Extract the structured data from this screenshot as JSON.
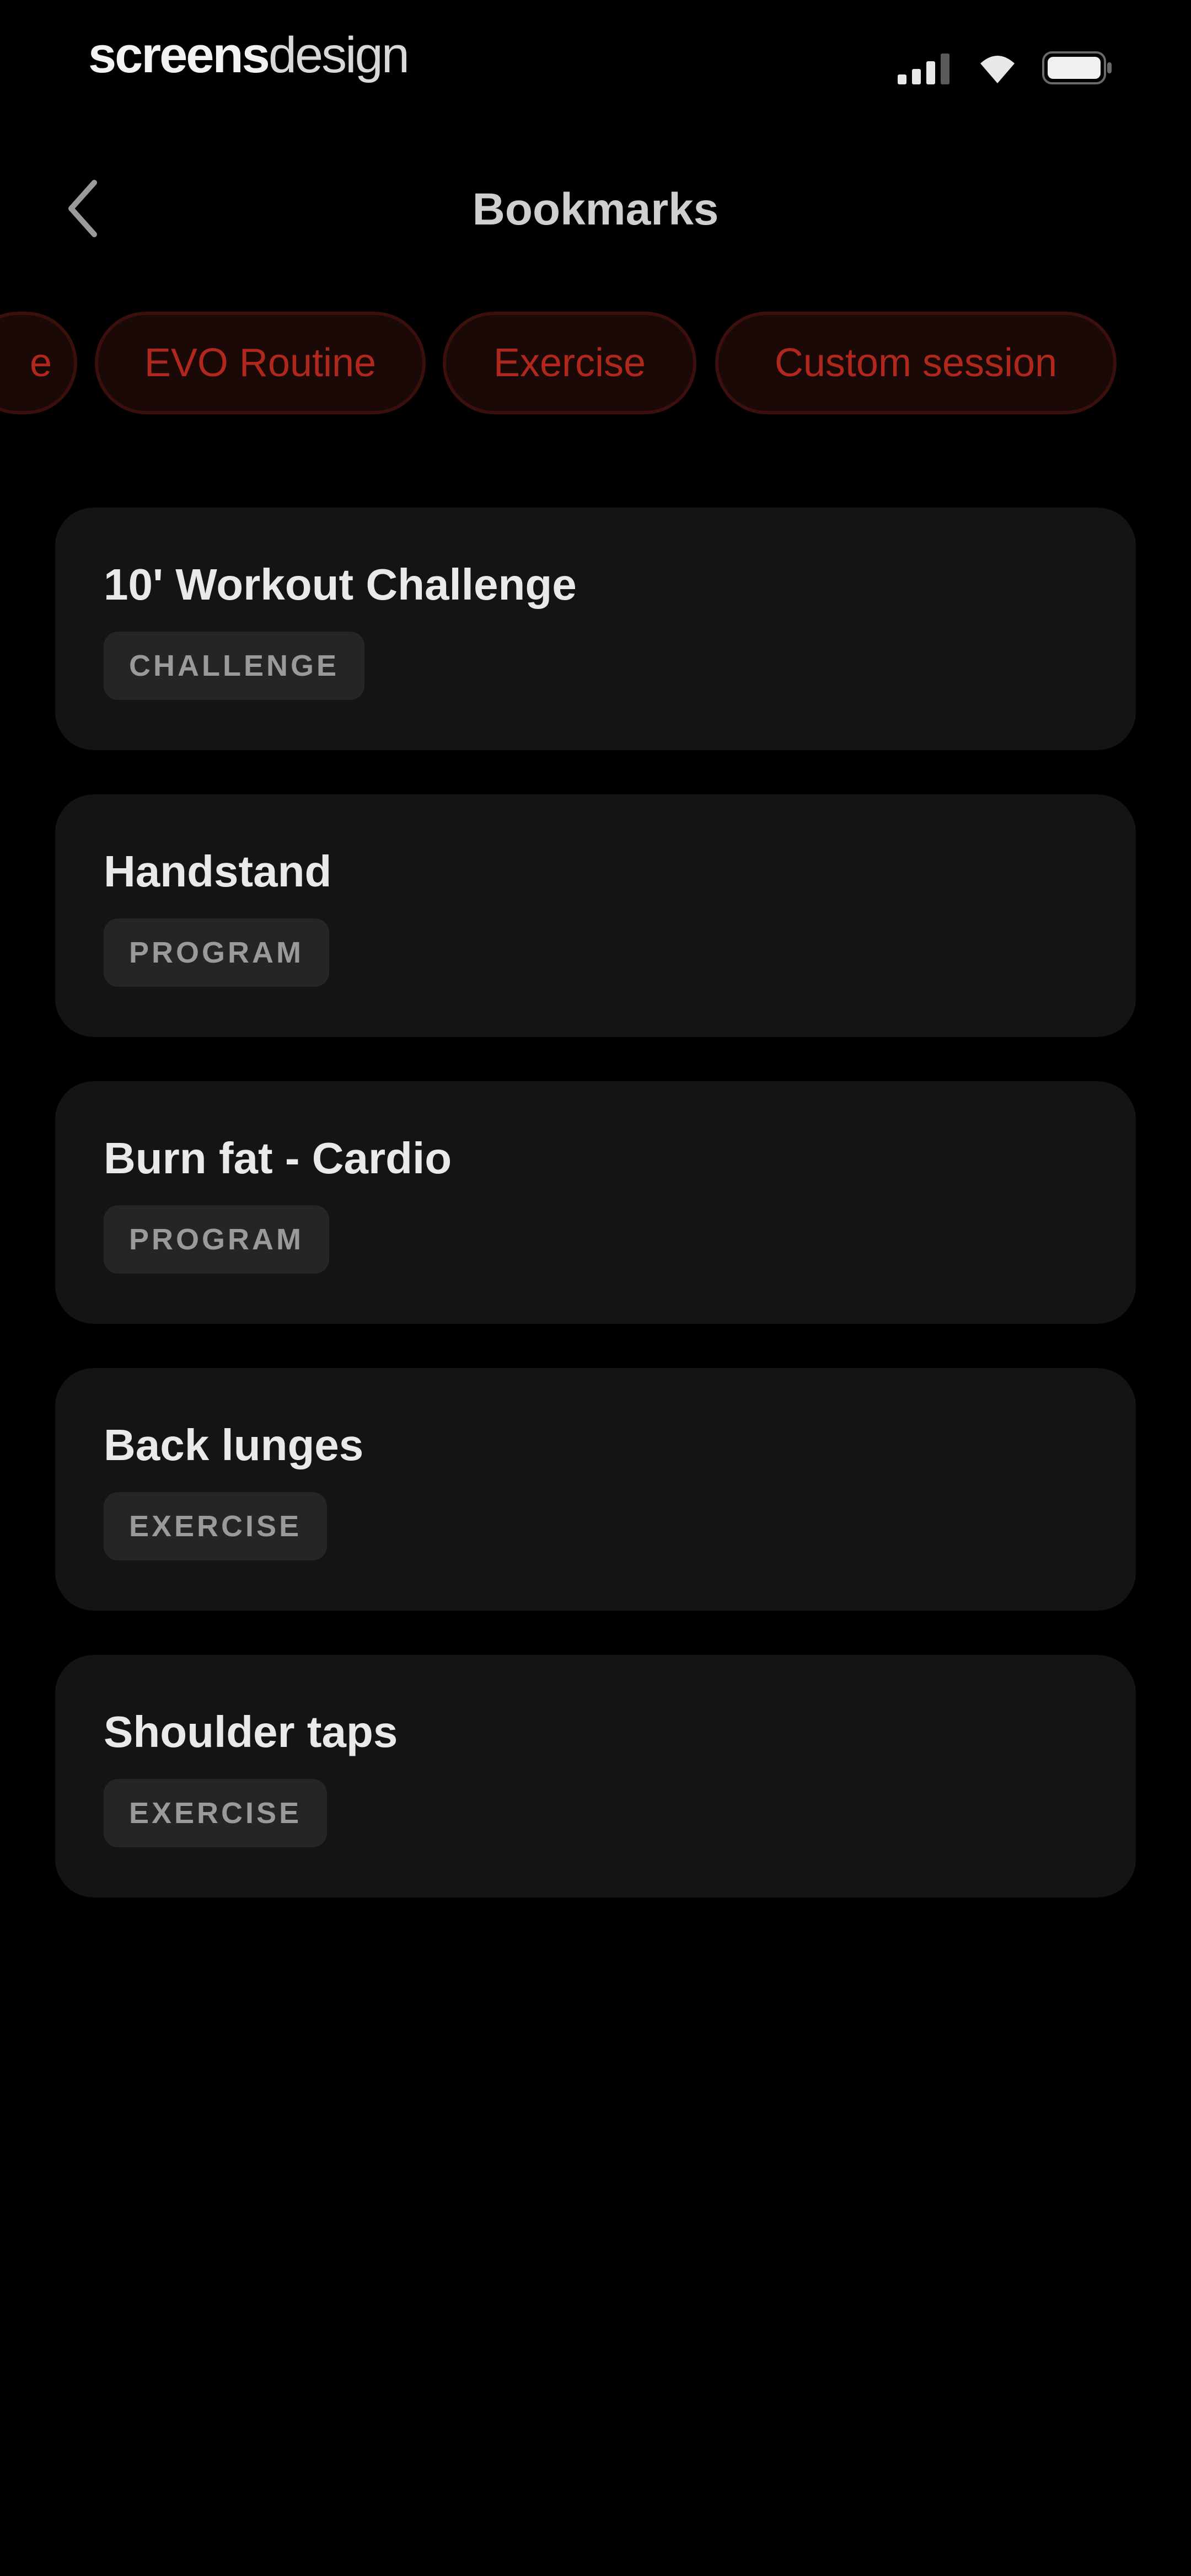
{
  "status_bar": {
    "brand_bold": "screens",
    "brand_light": "design",
    "icons": [
      "signal-icon",
      "wifi-icon",
      "battery-icon"
    ]
  },
  "header": {
    "back_icon": "chevron-left-icon",
    "title": "Bookmarks"
  },
  "filters": [
    {
      "label": "e"
    },
    {
      "label": "EVO Routine"
    },
    {
      "label": "Exercise"
    },
    {
      "label": "Custom session"
    }
  ],
  "bookmarks": [
    {
      "title": "10' Workout Challenge",
      "tag": "CHALLENGE"
    },
    {
      "title": "Handstand",
      "tag": "PROGRAM"
    },
    {
      "title": "Burn fat - Cardio",
      "tag": "PROGRAM"
    },
    {
      "title": "Back lunges",
      "tag": "EXERCISE"
    },
    {
      "title": "Shoulder taps",
      "tag": "EXERCISE"
    }
  ],
  "colors": {
    "background": "#000000",
    "card": "#141414",
    "chip_text": "#b0281d",
    "chip_border": "#3a0f0c"
  }
}
